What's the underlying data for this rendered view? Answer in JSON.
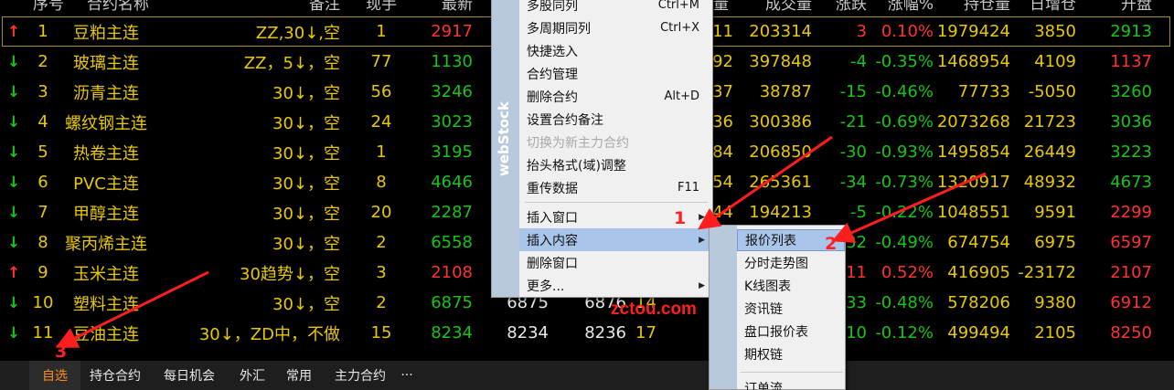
{
  "headers": {
    "seq": "序号",
    "name": "合约名称",
    "note": "备注",
    "qty": "现手",
    "last": "最新",
    "vol_unit": "量",
    "volume": "成交量",
    "change": "涨跌",
    "change_pct": "涨幅%",
    "oi": "持仓量",
    "oi_change": "日增仓",
    "open": "开盘"
  },
  "rows": [
    {
      "arrow": "↑",
      "dir": "up",
      "no": "1",
      "name": "豆粕主连",
      "note": "ZZ,30↓,空",
      "qty": "1",
      "last": "2917",
      "last_c": "rd",
      "bid": "",
      "ask": "",
      "col": "11",
      "volume": "203314",
      "change": "3",
      "change_c": "rd",
      "pct": "0.10%",
      "pct_c": "rd",
      "oi": "1979424",
      "oi_chg": "3850",
      "open": "2913",
      "open_c": "g"
    },
    {
      "arrow": "↓",
      "dir": "dn",
      "no": "2",
      "name": "玻璃主连",
      "note": "ZZ，5↓，空",
      "qty": "77",
      "last": "1130",
      "last_c": "g",
      "bid": "",
      "ask": "",
      "col": "92",
      "volume": "397848",
      "change": "-4",
      "change_c": "g",
      "pct": "-0.35%",
      "pct_c": "g",
      "oi": "1468954",
      "oi_chg": "4109",
      "open": "1137",
      "open_c": "rd"
    },
    {
      "arrow": "↓",
      "dir": "dn",
      "no": "3",
      "name": "沥青主连",
      "note": "30↓，空",
      "qty": "56",
      "last": "3246",
      "last_c": "g",
      "bid": "",
      "ask": "",
      "col": "37",
      "volume": "38787",
      "change": "-15",
      "change_c": "g",
      "pct": "-0.46%",
      "pct_c": "g",
      "oi": "77733",
      "oi_chg": "-5050",
      "open": "3260",
      "open_c": "g"
    },
    {
      "arrow": "↓",
      "dir": "dn",
      "no": "4",
      "name": "螺纹钢主连",
      "note": "30↓，空",
      "qty": "24",
      "last": "3023",
      "last_c": "g",
      "bid": "",
      "ask": "",
      "col": "36",
      "volume": "300386",
      "change": "-21",
      "change_c": "g",
      "pct": "-0.69%",
      "pct_c": "g",
      "oi": "2073268",
      "oi_chg": "21723",
      "open": "3036",
      "open_c": "g"
    },
    {
      "arrow": "↓",
      "dir": "dn",
      "no": "5",
      "name": "热卷主连",
      "note": "30↓，空",
      "qty": "1",
      "last": "3195",
      "last_c": "g",
      "bid": "",
      "ask": "",
      "col": "84",
      "volume": "206850",
      "change": "-30",
      "change_c": "g",
      "pct": "-0.93%",
      "pct_c": "g",
      "oi": "1495854",
      "oi_chg": "26449",
      "open": "3223",
      "open_c": "g"
    },
    {
      "arrow": "↓",
      "dir": "dn",
      "no": "6",
      "name": "PVC主连",
      "note": "30↓，空",
      "qty": "8",
      "last": "4646",
      "last_c": "g",
      "bid": "",
      "ask": "",
      "col": "54",
      "volume": "265361",
      "change": "-34",
      "change_c": "g",
      "pct": "-0.73%",
      "pct_c": "g",
      "oi": "1320917",
      "oi_chg": "48932",
      "open": "4673",
      "open_c": "g"
    },
    {
      "arrow": "↓",
      "dir": "dn",
      "no": "7",
      "name": "甲醇主连",
      "note": "30↓，空",
      "qty": "20",
      "last": "2287",
      "last_c": "g",
      "bid": "",
      "ask": "",
      "col": "44",
      "volume": "194213",
      "change": "-5",
      "change_c": "g",
      "pct": "-0.22%",
      "pct_c": "g",
      "oi": "1048551",
      "oi_chg": "9591",
      "open": "2299",
      "open_c": "rd"
    },
    {
      "arrow": "↓",
      "dir": "dn",
      "no": "8",
      "name": "聚丙烯主连",
      "note": "30↓，空",
      "qty": "2",
      "last": "6558",
      "last_c": "g",
      "bid": "",
      "ask": "",
      "col": "",
      "volume": "",
      "change": "-32",
      "change_c": "g",
      "pct": "-0.49%",
      "pct_c": "g",
      "oi": "674754",
      "oi_chg": "6975",
      "open": "6597",
      "open_c": "rd"
    },
    {
      "arrow": "↑",
      "dir": "up",
      "no": "9",
      "name": "玉米主连",
      "note": "30趋势↓，空",
      "qty": "3",
      "last": "2108",
      "last_c": "rd",
      "bid": "",
      "ask": "",
      "col": "",
      "volume": "",
      "change": "11",
      "change_c": "rd",
      "pct": "0.52%",
      "pct_c": "rd",
      "oi": "416905",
      "oi_chg": "-23172",
      "open": "2107",
      "open_c": "rd"
    },
    {
      "arrow": "↓",
      "dir": "dn",
      "no": "10",
      "name": "塑料主连",
      "note": "30↓，空",
      "qty": "2",
      "last": "6875",
      "last_c": "g",
      "bid": "6875",
      "ask": "6876",
      "col": "14",
      "volume": "",
      "change": "-33",
      "change_c": "g",
      "pct": "-0.48%",
      "pct_c": "g",
      "oi": "578206",
      "oi_chg": "9380",
      "open": "6912",
      "open_c": "rd"
    },
    {
      "arrow": "↓",
      "dir": "dn",
      "no": "11",
      "name": "豆油主连",
      "note": "30↓，ZD中，不做",
      "qty": "15",
      "last": "8234",
      "last_c": "g",
      "bid": "8234",
      "ask": "8236",
      "col": "17",
      "volume": "",
      "change": "-10",
      "change_c": "g",
      "pct": "-0.12%",
      "pct_c": "g",
      "oi": "499494",
      "oi_chg": "2105",
      "open": "8250",
      "open_c": "rd"
    }
  ],
  "tabs": [
    {
      "label": "自选",
      "active": true
    },
    {
      "label": "持仓合约"
    },
    {
      "label": "每日机会"
    },
    {
      "label": "外汇"
    },
    {
      "label": "常用"
    },
    {
      "label": "主力合约"
    },
    {
      "label": "···"
    }
  ],
  "menu": [
    {
      "label": "多股同列",
      "shortcut": "Ctrl+M"
    },
    {
      "label": "多周期同列",
      "shortcut": "Ctrl+X"
    },
    {
      "label": "快捷选入"
    },
    {
      "label": "合约管理"
    },
    {
      "label": "删除合约",
      "shortcut": "Alt+D"
    },
    {
      "label": "设置合约备注"
    },
    {
      "label": "切换为新主力合约",
      "disabled": true
    },
    {
      "label": "抬头格式(域)调整"
    },
    {
      "label": "重传数据",
      "shortcut": "F11"
    },
    {
      "sep": true
    },
    {
      "label": "插入窗口",
      "submenu": true
    },
    {
      "label": "插入内容",
      "submenu": true,
      "highlighted": true
    },
    {
      "label": "删除窗口"
    },
    {
      "label": "更多...",
      "submenu": true
    }
  ],
  "menu_side_text": "webStock",
  "submenu": [
    {
      "label": "报价列表",
      "highlighted": true
    },
    {
      "label": "分时走势图"
    },
    {
      "label": "K线图表"
    },
    {
      "label": "资讯链"
    },
    {
      "label": "盘口报价表"
    },
    {
      "label": "期权链"
    },
    {
      "sep": true
    },
    {
      "label": "订单流"
    }
  ],
  "annotations": [
    "1",
    "2",
    "3"
  ],
  "watermark": "zctou.com"
}
